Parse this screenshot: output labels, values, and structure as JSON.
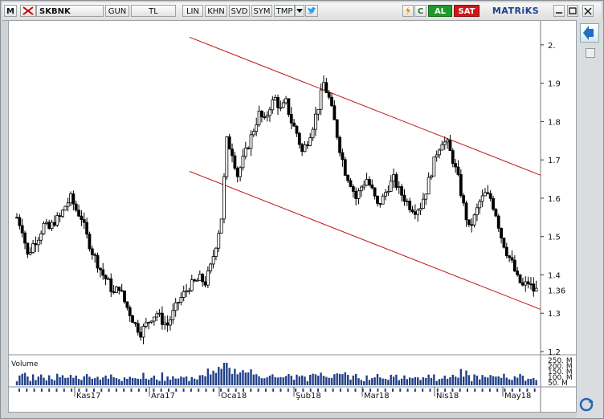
{
  "toolbar": {
    "menu": "M",
    "symbol": "SKBNK",
    "period": "GUN",
    "currency": "TL",
    "lin": "LIN",
    "khn": "KHN",
    "svd": "SVD",
    "sym": "SYM",
    "tmp": "TMP",
    "c": "C",
    "al": "AL",
    "sat": "SAT",
    "brand": "MATRiKS"
  },
  "chart_data": [
    {
      "type": "candlestick",
      "title": "SKBNK",
      "ylim": [
        1.2,
        2.05
      ],
      "y_ticks": [
        "2.",
        "1.9",
        "1.8",
        "1.7",
        "1.6",
        "1.5",
        "1.4",
        "1.3",
        "1.2"
      ],
      "last_price": "1.36",
      "x_tick_labels": [
        "Kas17",
        "Ara17",
        "Oca18",
        "Şub18",
        "Mar18",
        "Nis18",
        "May18"
      ],
      "price_path": [
        1.55,
        1.52,
        1.45,
        1.48,
        1.5,
        1.53,
        1.52,
        1.54,
        1.55,
        1.58,
        1.6,
        1.57,
        1.55,
        1.5,
        1.46,
        1.43,
        1.4,
        1.38,
        1.35,
        1.37,
        1.33,
        1.3,
        1.27,
        1.25,
        1.27,
        1.29,
        1.3,
        1.28,
        1.27,
        1.3,
        1.33,
        1.35,
        1.37,
        1.38,
        1.39,
        1.38,
        1.42,
        1.48,
        1.55,
        1.75,
        1.72,
        1.66,
        1.7,
        1.74,
        1.78,
        1.82,
        1.8,
        1.84,
        1.86,
        1.83,
        1.85,
        1.8,
        1.77,
        1.72,
        1.75,
        1.79,
        1.84,
        1.9,
        1.86,
        1.8,
        1.73,
        1.67,
        1.64,
        1.6,
        1.63,
        1.65,
        1.62,
        1.58,
        1.6,
        1.63,
        1.65,
        1.62,
        1.6,
        1.58,
        1.57,
        1.58,
        1.62,
        1.67,
        1.72,
        1.75,
        1.74,
        1.7,
        1.65,
        1.58,
        1.52,
        1.55,
        1.59,
        1.61,
        1.6,
        1.56,
        1.5,
        1.46,
        1.43,
        1.39,
        1.37,
        1.38,
        1.36
      ],
      "channel": {
        "upper": [
          [
            0.0,
            2.02
          ],
          [
            1.0,
            1.66
          ]
        ],
        "lower": [
          [
            0.0,
            1.67
          ],
          [
            1.0,
            1.31
          ]
        ]
      },
      "volume_label": "Volume",
      "volume_axis": [
        "250. M",
        "200. M",
        "150. M",
        "100. M",
        "50. M"
      ]
    }
  ]
}
